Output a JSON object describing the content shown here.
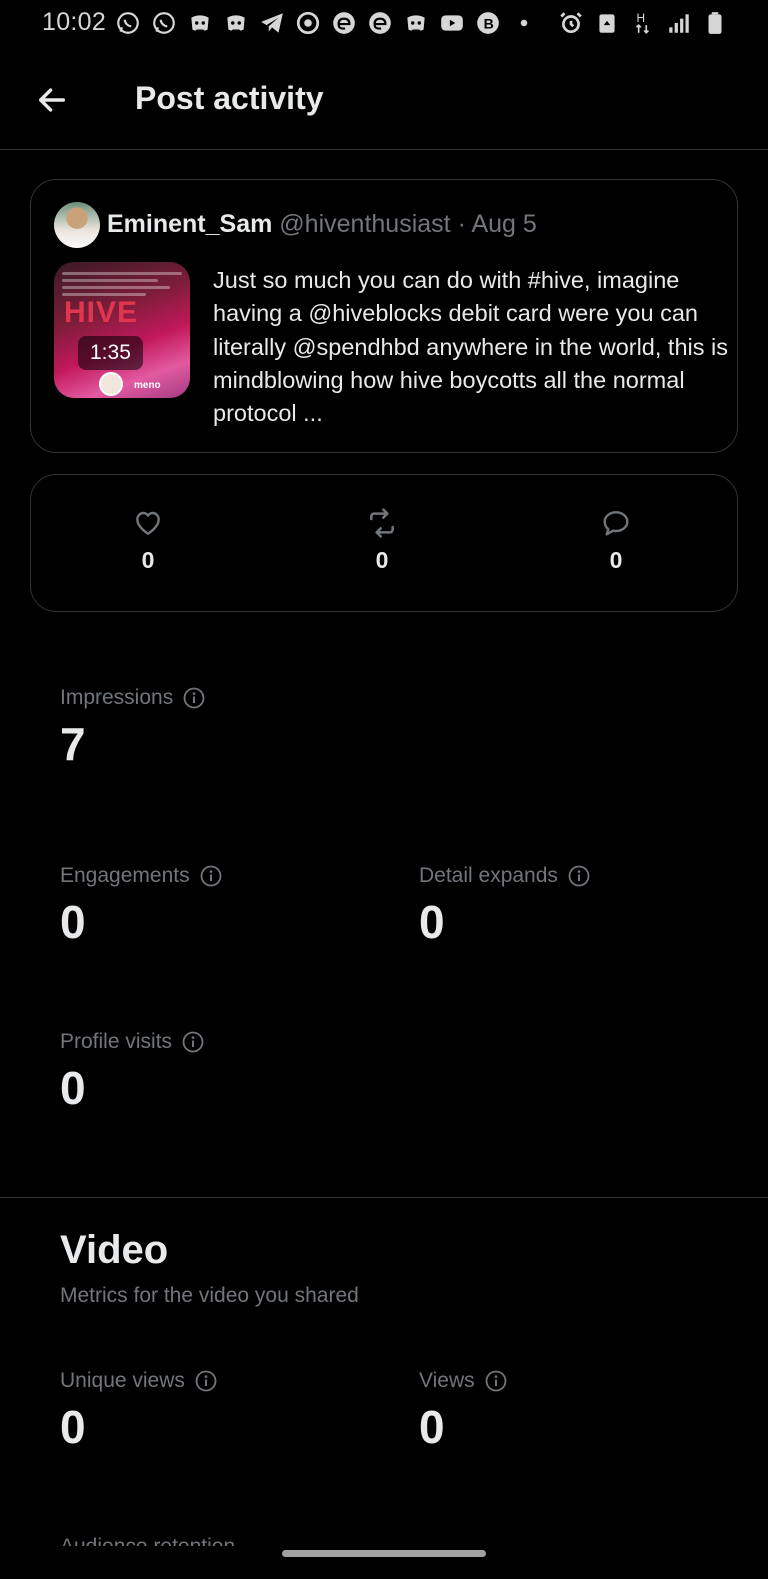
{
  "status_bar": {
    "time": "10:02",
    "left_icons": [
      "whatsapp-icon",
      "whatsapp-icon",
      "discord-icon",
      "discord-icon",
      "telegram-icon",
      "chrome-icon",
      "edge-icon",
      "edge-icon",
      "discord-icon",
      "youtube-icon",
      "b-app-icon",
      "dot-icon"
    ],
    "right_icons": [
      "alarm-icon",
      "recycle-icon",
      "network-h-icon",
      "signal-icon",
      "battery-icon"
    ]
  },
  "header": {
    "title": "Post activity"
  },
  "post": {
    "author": "Eminent_Sam",
    "handle": "@hiventhusiast",
    "separator": "·",
    "date": "Aug 5",
    "video_duration": "1:35",
    "thumb_text": "HIVE",
    "thumb_tag": "meno",
    "text": "Just so much you can do with #hive, imagine  having  a @hiveblocks  debit card were you can literally @spendhbd anywhere in the world, this is mindblowing how hive boycotts all the normal protocol ..."
  },
  "actions": {
    "likes": "0",
    "reposts": "0",
    "replies": "0"
  },
  "metrics": {
    "impressions": {
      "label": "Impressions",
      "value": "7"
    },
    "engagements": {
      "label": "Engagements",
      "value": "0"
    },
    "detail_expands": {
      "label": "Detail expands",
      "value": "0"
    },
    "profile_visits": {
      "label": "Profile visits",
      "value": "0"
    }
  },
  "video_section": {
    "title": "Video",
    "subtitle": "Metrics for the video you shared",
    "unique_views": {
      "label": "Unique views",
      "value": "0"
    },
    "views": {
      "label": "Views",
      "value": "0"
    },
    "cutoff_label": "Audience retention"
  },
  "colors": {
    "background": "#000000",
    "text_primary": "#e7e9ea",
    "text_secondary": "#71767b",
    "border": "#2f3336"
  }
}
